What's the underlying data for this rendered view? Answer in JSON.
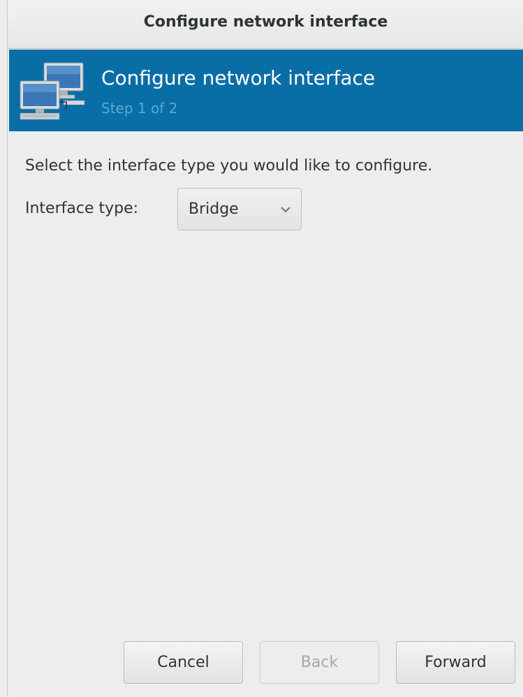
{
  "window": {
    "title": "Configure network interface"
  },
  "banner": {
    "title": "Configure network interface",
    "step": "Step 1 of 2",
    "icon": "network-computers-icon",
    "background_color": "#0a6ea6"
  },
  "content": {
    "instruction": "Select the interface type you would like to configure.",
    "interface_type_label": "Interface type:",
    "interface_type_value": "Bridge"
  },
  "buttons": {
    "cancel": "Cancel",
    "back": "Back",
    "back_enabled": false,
    "forward": "Forward"
  }
}
